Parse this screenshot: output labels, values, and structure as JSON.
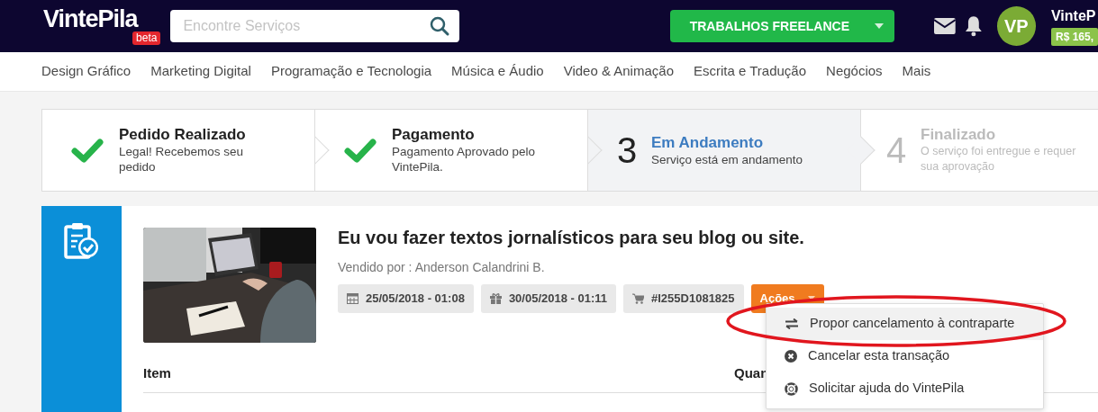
{
  "header": {
    "logo": "VintePila",
    "logo_badge": "beta",
    "search": {
      "placeholder": "Encontre Serviços"
    },
    "freelance_button": "TRABALHOS FREELANCE",
    "user": {
      "avatar": "VP",
      "name": "VinteP",
      "balance": "R$ 165,"
    }
  },
  "categories": [
    "Design Gráfico",
    "Marketing Digital",
    "Programação e Tecnologia",
    "Música e Áudio",
    "Video & Animação",
    "Escrita e Tradução",
    "Negócios",
    "Mais"
  ],
  "steps": [
    {
      "title": "Pedido Realizado",
      "description": "Legal! Recebemos seu pedido",
      "done": true,
      "active": false
    },
    {
      "title": "Pagamento",
      "description": "Pagamento Aprovado pelo VintePila.",
      "done": true,
      "active": false
    },
    {
      "number": "3",
      "title": "Em Andamento",
      "description": "Serviço está em andamento",
      "done": false,
      "active": true
    },
    {
      "number": "4",
      "title": "Finalizado",
      "description": "O serviço foi entregue e requer sua aprovação",
      "done": false,
      "active": false
    }
  ],
  "order": {
    "title": "Eu vou fazer textos jornalísticos para seu blog ou site.",
    "seller": "Vendido por : Anderson Calandrini B.",
    "chips": [
      {
        "kind": "date",
        "text": "25/05/2018 - 01:08"
      },
      {
        "kind": "delivery",
        "text": "30/05/2018 - 01:11"
      },
      {
        "kind": "order",
        "text": "#I255D1081825"
      }
    ],
    "actions": {
      "label": "Ações",
      "expanded": true,
      "items": [
        {
          "kind": "swap",
          "label": "Propor cancelamento à contraparte",
          "selected": true,
          "highlighted": true
        },
        {
          "kind": "cancel",
          "label": "Cancelar esta transação",
          "selected": false,
          "highlighted": false
        },
        {
          "kind": "help",
          "label": "Solicitar ajuda do VintePila",
          "selected": false,
          "highlighted": false
        }
      ]
    }
  },
  "table": {
    "columns": [
      "Item",
      "Quan"
    ]
  }
}
